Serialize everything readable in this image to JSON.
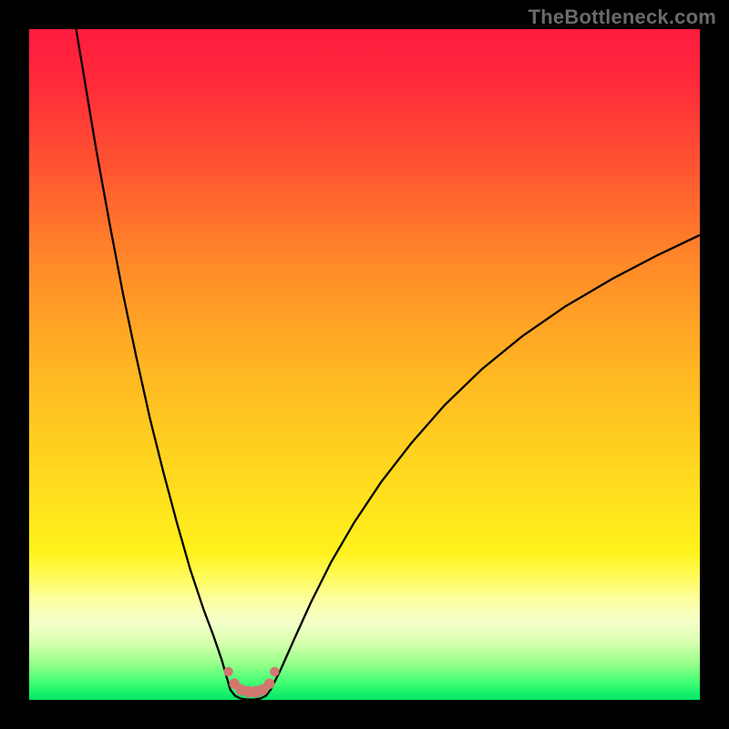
{
  "watermark": "TheBottleneck.com",
  "colors": {
    "black": "#000000",
    "curve": "#000000",
    "marker_fill": "#d1776f",
    "marker_stroke": "#c15852",
    "gradient_stops": [
      {
        "offset": 0.0,
        "color": "#ff1b3f"
      },
      {
        "offset": 0.08,
        "color": "#ff2a3a"
      },
      {
        "offset": 0.2,
        "color": "#ff5231"
      },
      {
        "offset": 0.35,
        "color": "#ff8a29"
      },
      {
        "offset": 0.5,
        "color": "#ffb423"
      },
      {
        "offset": 0.65,
        "color": "#ffd61f"
      },
      {
        "offset": 0.78,
        "color": "#fff21c"
      },
      {
        "offset": 0.82,
        "color": "#fffb60"
      },
      {
        "offset": 0.85,
        "color": "#fcffa0"
      },
      {
        "offset": 0.885,
        "color": "#f3ffca"
      },
      {
        "offset": 0.915,
        "color": "#d7ffae"
      },
      {
        "offset": 0.945,
        "color": "#98ff8a"
      },
      {
        "offset": 0.975,
        "color": "#3dff72"
      },
      {
        "offset": 1.0,
        "color": "#00e765"
      }
    ]
  },
  "chart_data": {
    "type": "line",
    "title": "",
    "xlabel": "",
    "ylabel": "",
    "xlim": [
      0,
      100
    ],
    "ylim": [
      0,
      100
    ],
    "grid": false,
    "series": [
      {
        "name": "left-branch",
        "x": [
          7.0,
          8.5,
          10.0,
          12.0,
          14.0,
          16.0,
          18.0,
          20.0,
          22.0,
          24.0,
          26.0,
          27.5,
          28.7,
          29.5,
          30.0
        ],
        "y": [
          100.0,
          91.0,
          82.0,
          71.0,
          60.5,
          51.0,
          42.0,
          34.0,
          26.5,
          19.5,
          13.5,
          9.5,
          6.0,
          3.2,
          1.5
        ]
      },
      {
        "name": "valley",
        "x": [
          30.0,
          30.7,
          31.5,
          32.5,
          33.5,
          34.5,
          35.3,
          36.0
        ],
        "y": [
          1.5,
          0.6,
          0.2,
          0.05,
          0.05,
          0.2,
          0.6,
          1.5
        ]
      },
      {
        "name": "right-branch",
        "x": [
          36.0,
          37.5,
          39.5,
          42.0,
          45.0,
          48.5,
          52.5,
          57.0,
          62.0,
          67.5,
          73.5,
          80.0,
          87.0,
          93.5,
          100.0
        ],
        "y": [
          1.5,
          4.5,
          9.0,
          14.5,
          20.5,
          26.5,
          32.5,
          38.3,
          44.0,
          49.3,
          54.2,
          58.7,
          62.8,
          66.2,
          69.3
        ]
      }
    ],
    "markers": {
      "name": "valley-markers",
      "x": [
        29.7,
        30.6,
        31.6,
        32.7,
        33.8,
        34.8,
        35.8,
        36.6
      ],
      "y": [
        4.2,
        2.4,
        1.5,
        1.2,
        1.2,
        1.5,
        2.4,
        4.2
      ],
      "r": [
        5.2,
        5.8,
        6.2,
        6.4,
        6.4,
        6.2,
        5.8,
        5.2
      ]
    }
  }
}
